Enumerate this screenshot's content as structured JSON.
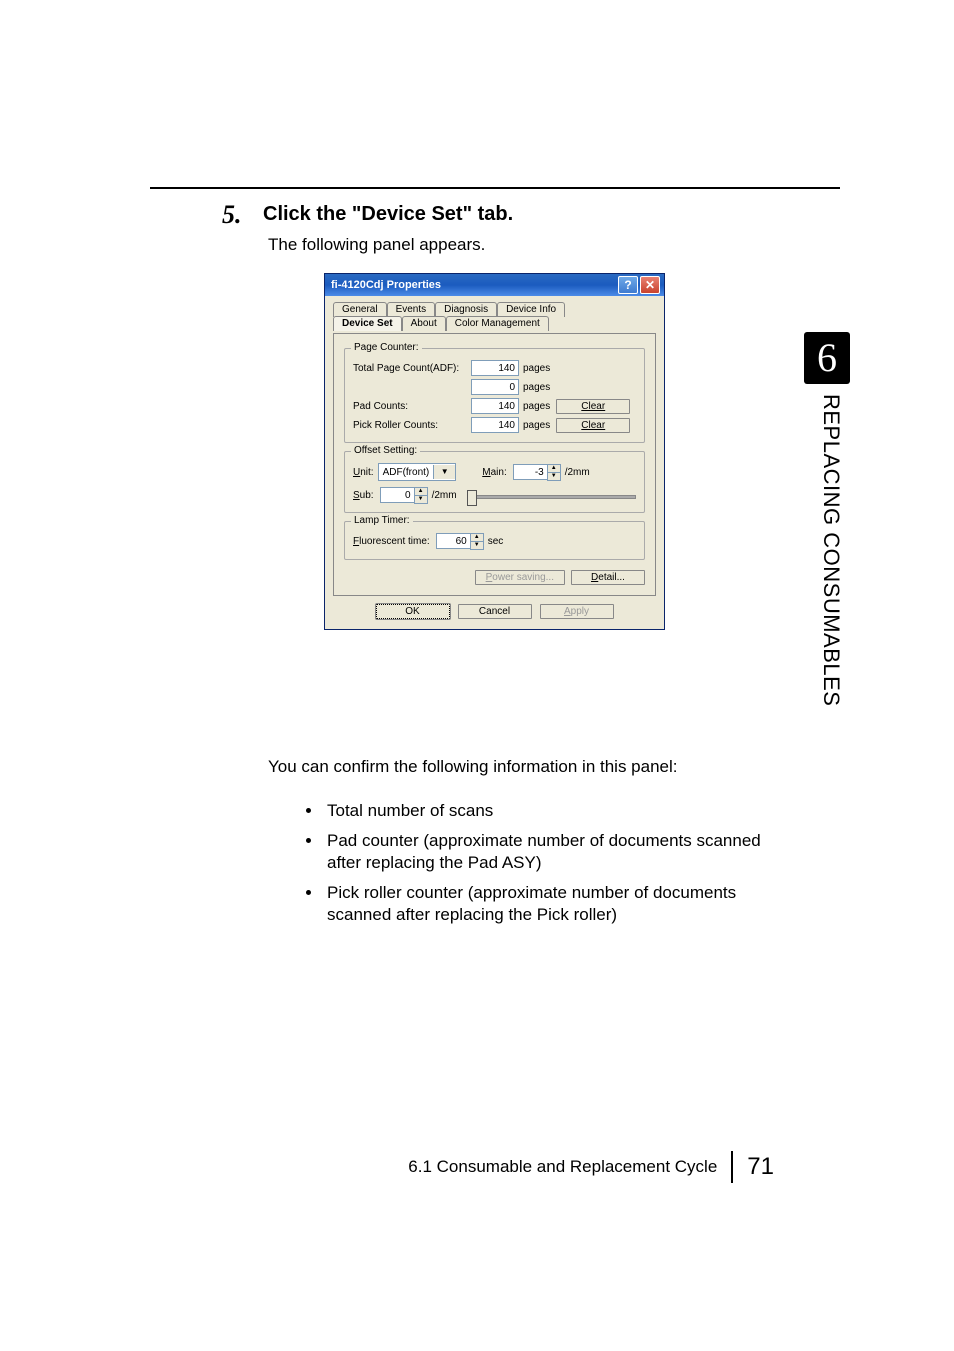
{
  "step_number": "5.",
  "step_title": "Click the \"Device Set\" tab.",
  "subtitle": "The following panel appears.",
  "dialog": {
    "title": "fi-4120Cdj Properties",
    "help": "?",
    "close": "✕",
    "tabs_back": [
      "General",
      "Events",
      "Diagnosis",
      "Device Info"
    ],
    "tabs_front": [
      "Device Set",
      "About",
      "Color Management"
    ],
    "page_counter": {
      "legend": "Page Counter:",
      "total_label": "Total Page Count(ADF):",
      "total_value": "140",
      "pages": "pages",
      "blank_value": "0",
      "pad_label": "Pad Counts:",
      "pad_value": "140",
      "pick_label": "Pick Roller Counts:",
      "pick_value": "140",
      "clear": "Clear"
    },
    "offset": {
      "legend": "Offset Setting:",
      "unit_u": "U",
      "unit_rest": "nit:",
      "unit_value": "ADF(front)",
      "main_m": "M",
      "main_rest": "ain:",
      "main_value": "-3",
      "sub_s": "S",
      "sub_rest": "ub:",
      "sub_value": "0",
      "mm72": "/2mm"
    },
    "lamp": {
      "legend": "Lamp Timer:",
      "fl_f": "F",
      "fl_rest": "luorescent time:",
      "value": "60",
      "sec": "sec"
    },
    "power_p": "P",
    "power_rest": "ower saving...",
    "detail_d": "D",
    "detail_rest": "etail...",
    "ok": "OK",
    "cancel": "Cancel",
    "apply_a": "A",
    "apply_rest": "pply"
  },
  "confirm": "You can confirm the following information in this panel:",
  "bullets": [
    "Total number of scans",
    "Pad counter (approximate number of documents scanned after replacing the Pad ASY)",
    "Pick roller counter (approximate number of documents scanned after replacing the Pick roller)"
  ],
  "side_num": "6",
  "side_text": "REPLACING CONSUMABLES",
  "footer_text": "6.1  Consumable and Replacement Cycle",
  "footer_page": "71"
}
